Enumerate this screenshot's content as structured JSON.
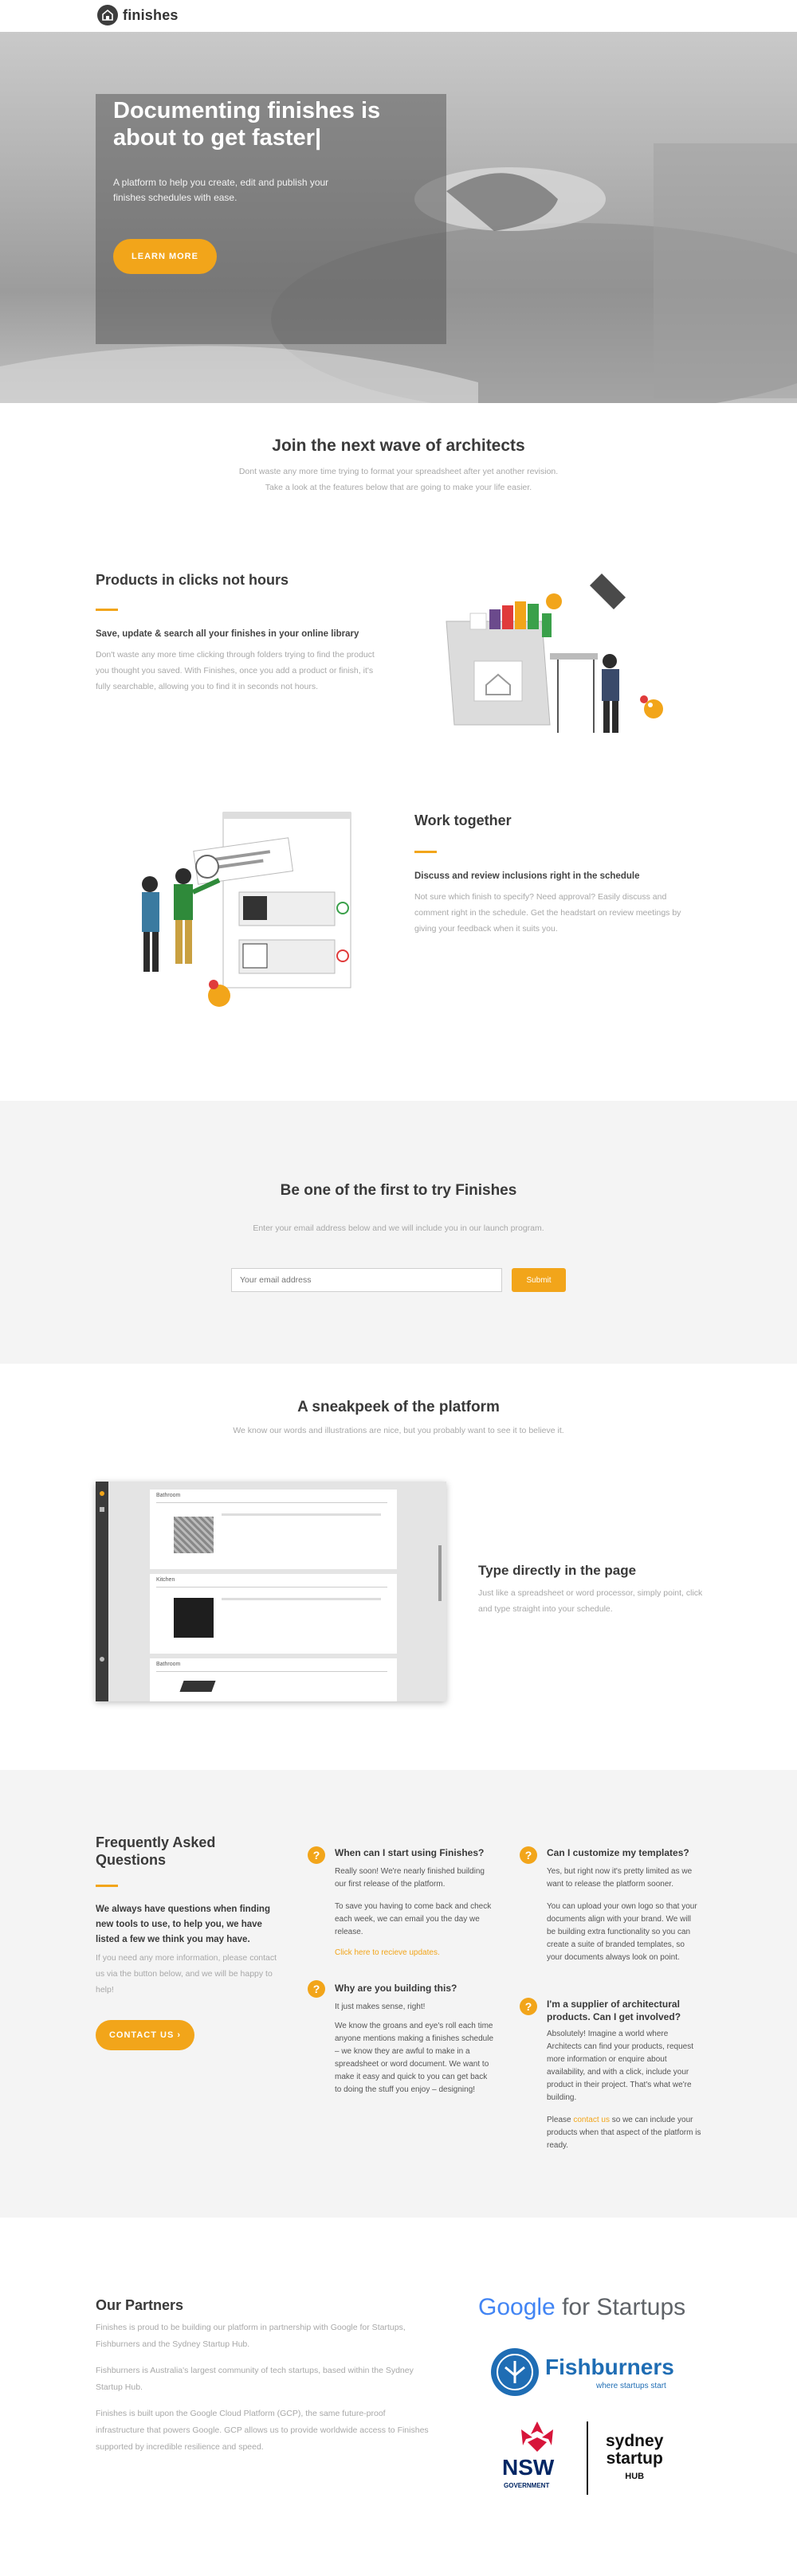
{
  "nav": {
    "brand": "finishes"
  },
  "hero": {
    "title": "Documenting finishes is about to get faster|",
    "subtitle": "A platform to help you create, edit and publish your finishes schedules with ease.",
    "cta": "LEARN MORE"
  },
  "join": {
    "title": "Join the next wave of architects",
    "line1": "Dont waste any more time trying to format your spreadsheet after yet another revision.",
    "line2": "Take a look at the features below that are going to make your life easier."
  },
  "feature_products": {
    "title": "Products in clicks not hours",
    "heading": "Save, update & search all your finishes in your online library",
    "body": "Don't waste any more time clicking through folders trying to find the product you thought you saved. With Finishes, once you add a product or finish, it's fully searchable, allowing you to find it in seconds not hours."
  },
  "feature_together": {
    "title": "Work together",
    "heading": "Discuss and review inclusions right in the schedule",
    "body": "Not sure which finish to specify? Need approval? Easily discuss and comment right in the schedule. Get the headstart on review meetings by giving your feedback when it suits you."
  },
  "signup": {
    "title": "Be one of the first to try Finishes",
    "sub": "Enter your email address below and we will include you in our launch program.",
    "placeholder": "Your email address",
    "submit": "Submit"
  },
  "sneak": {
    "title": "A sneakpeek of the platform",
    "sub": "We know our words and illustrations are nice, but you probably want to see it to believe it.",
    "feature_title": "Type directly in the page",
    "feature_body": "Just like a spreadsheet or word processor, simply point, click and type straight into your schedule.",
    "sections": [
      "Bathroom",
      "Kitchen",
      "Bathroom"
    ]
  },
  "faq": {
    "title": "Frequently Asked Questions",
    "lead": "We always have questions when finding new tools to use, to help you, we have listed a few we think you may have.",
    "note": "If you need any more information, please contact us via the button below, and we will be happy to help!",
    "cta": "CONTACT US",
    "items": [
      {
        "q": "When can I start using Finishes?",
        "a1": "Really soon! We're nearly finished building our first release of the platform.",
        "a2": "To save you having to come back and check each week, we can email you the day we release.",
        "link": "Click here to recieve updates."
      },
      {
        "q": "Why are you building this?",
        "a1": "It just makes sense, right!",
        "a2": "We know the groans and eye's roll each time anyone mentions making a finishes schedule – we know they are awful to make in a spreadsheet or word document. We want to make it easy and quick to you can get back to doing the stuff you enjoy – designing!"
      },
      {
        "q": "Can I customize my templates?",
        "a1": "Yes, but right now it's pretty limited as we want to release the platform sooner.",
        "a2": "You can upload your own logo so that your documents align with your brand. We will be building extra functionality so you can create a suite of branded templates, so your documents always look on point."
      },
      {
        "q": "I'm a supplier of architectural products. Can I get involved?",
        "a1": "Absolutely! Imagine a world where Architects can find your products, request more information or enquire about availability, and with a click, include your product in their project. That's what we're building.",
        "a2_pre": "Please ",
        "a2_link": "contact us",
        "a2_post": " so we can include your products when that aspect of the platform is ready."
      }
    ]
  },
  "partners": {
    "title": "Our Partners",
    "p1": "Finishes is proud to be building our platform in partnership with Google for Startups, Fishburners and the Sydney Startup Hub.",
    "p2": "Fishburners is Australia's largest community of tech startups, based within the Sydney Startup Hub.",
    "p3": "Finishes is built upon the Google Cloud Platform (GCP), the same future-proof infrastructure that powers Google. GCP allows us to provide worldwide access to Finishes supported by incredible resilience and speed.",
    "google_word": "Google",
    "google_tail": " for Startups",
    "fishburners": "Fishburners",
    "fishburners_tag": "where startups start",
    "nsw": "NSW",
    "nsw_gov": "GOVERNMENT",
    "ssh1": "sydney",
    "ssh2": "startup",
    "ssh3": "HUB"
  }
}
